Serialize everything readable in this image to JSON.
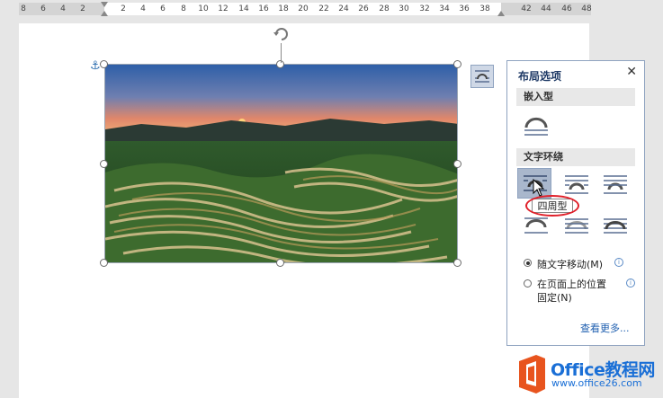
{
  "ruler": {
    "left_labels": [
      "8",
      "6",
      "4",
      "2"
    ],
    "right_labels": [
      "2",
      "4",
      "6",
      "8",
      "10",
      "12",
      "14",
      "16",
      "18",
      "20",
      "22",
      "24",
      "26",
      "28",
      "30",
      "32",
      "34",
      "36",
      "38",
      "42",
      "44",
      "46",
      "48"
    ]
  },
  "panel": {
    "title": "布局选项",
    "inline_section": "嵌入型",
    "wrap_section": "文字环绕",
    "tooltip": "四周型",
    "radio_move": "随文字移动(M)",
    "radio_fixed_line1": "在页面上的位置",
    "radio_fixed_line2": "固定(N)",
    "see_more": "查看更多..."
  },
  "watermark": {
    "name": "Office教程网",
    "url": "www.office26.com"
  },
  "colors": {
    "panel_title": "#1f3a66",
    "selection_fill": "#a9b7cc",
    "highlight_ring": "#e0202a",
    "logo_orange": "#e8541e",
    "logo_blue": "#1a6fd6"
  },
  "icons": [
    "anchor-icon",
    "rotate-icon",
    "layout-options-icon",
    "close-icon",
    "inline-wrap-icon",
    "square-wrap-icon",
    "tight-wrap-icon",
    "through-wrap-icon",
    "top-bottom-wrap-icon",
    "behind-text-icon",
    "in-front-text-icon",
    "info-icon",
    "office-logo-icon",
    "mouse-cursor-icon"
  ]
}
